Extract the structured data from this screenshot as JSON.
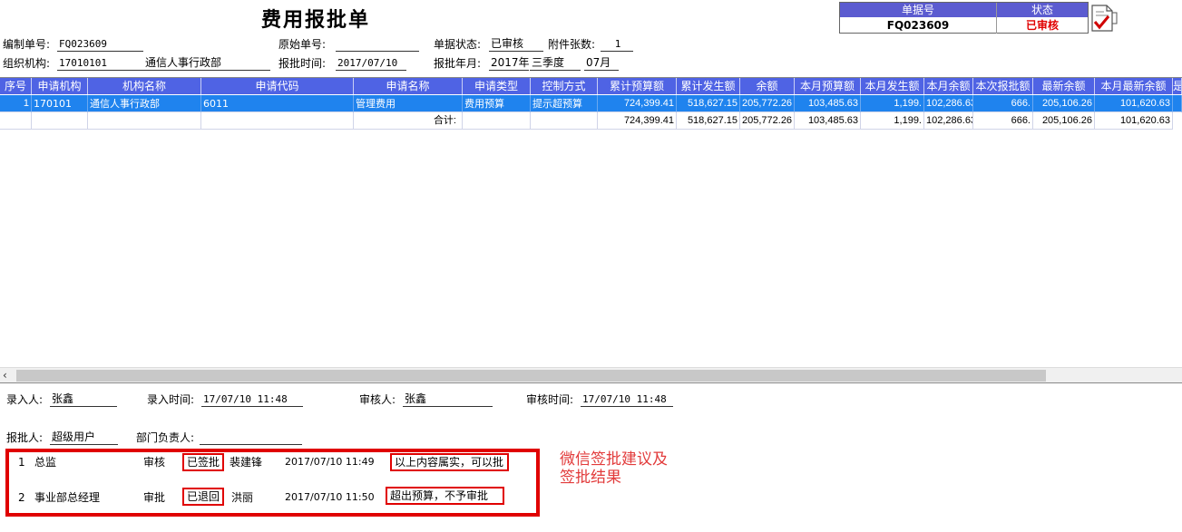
{
  "title": "费用报批单",
  "docbox": {
    "no_label": "单据号",
    "no_value": "FQ023609",
    "status_label": "状态",
    "status_value": "已审核",
    "status_color": "#e00000"
  },
  "form": {
    "bianzhi_label": "编制单号:",
    "bianzhi_value": "FQ023609",
    "yuanshi_label": "原始单号:",
    "yuanshi_value": "",
    "djzt_label": "单据状态:",
    "djzt_value": "已审核",
    "fjzs_label": "附件张数:",
    "fjzs_value": "1",
    "org_label": "组织机构:",
    "org_code": "17010101",
    "org_name": "通信人事行政部",
    "bpsj_label": "报批时间:",
    "bpsj_value": "2017/07/10",
    "bpny_label": "报批年月:",
    "bpny_year": "2017年",
    "bpny_quarter": "三季度",
    "bpny_month": "07月"
  },
  "grid": {
    "header_color": "#4f63e4",
    "select_color": "#1f83ee",
    "columns": [
      "序号",
      "申请机构",
      "机构名称",
      "申请代码",
      "申请名称",
      "申请类型",
      "控制方式",
      "累计预算额",
      "累计发生额",
      "余额",
      "本月预算额",
      "本月发生额",
      "本月余额",
      "本次报批额",
      "最新余额",
      "本月最新余额",
      "是"
    ],
    "rows": [
      [
        "1",
        "170101",
        "通信人事行政部",
        "6011",
        "管理费用",
        "费用预算",
        "提示超预算",
        "724,399.41",
        "518,627.15",
        "205,772.26",
        "103,485.63",
        "1,199.",
        "102,286.63",
        "666.",
        "205,106.26",
        "101,620.63",
        ""
      ]
    ],
    "total": {
      "label": "合计:",
      "values": [
        "724,399.41",
        "518,627.15",
        "205,772.26",
        "103,485.63",
        "1,199.",
        "102,286.63",
        "666.",
        "205,106.26",
        "101,620.63"
      ]
    }
  },
  "footer": {
    "lrr_label": "录入人:",
    "lrr_value": "张鑫",
    "lrsj_label": "录入时间:",
    "lrsj_value": "17/07/10 11:48",
    "shr_label": "审核人:",
    "shr_value": "张鑫",
    "shsj_label": "审核时间:",
    "shsj_value": "17/07/10 11:48",
    "bpr_label": "报批人:",
    "bpr_value": "超级用户",
    "bmfzr_label": "部门负责人:",
    "bmfzr_value": ""
  },
  "approvals": [
    {
      "no": "1",
      "role": "总监",
      "action": "审核",
      "result": "已签批",
      "person": "裴建锋",
      "time": "2017/07/10 11:49",
      "comment": "以上内容属实，可以批"
    },
    {
      "no": "2",
      "role": "事业部总经理",
      "action": "审批",
      "result": "已退回",
      "person": "洪丽",
      "time": "2017/07/10 11:50",
      "comment": "超出预算，不予审批"
    }
  ],
  "annotation": {
    "line1": "微信签批建议及",
    "line2": "签批结果",
    "color": "#e23b3b"
  }
}
